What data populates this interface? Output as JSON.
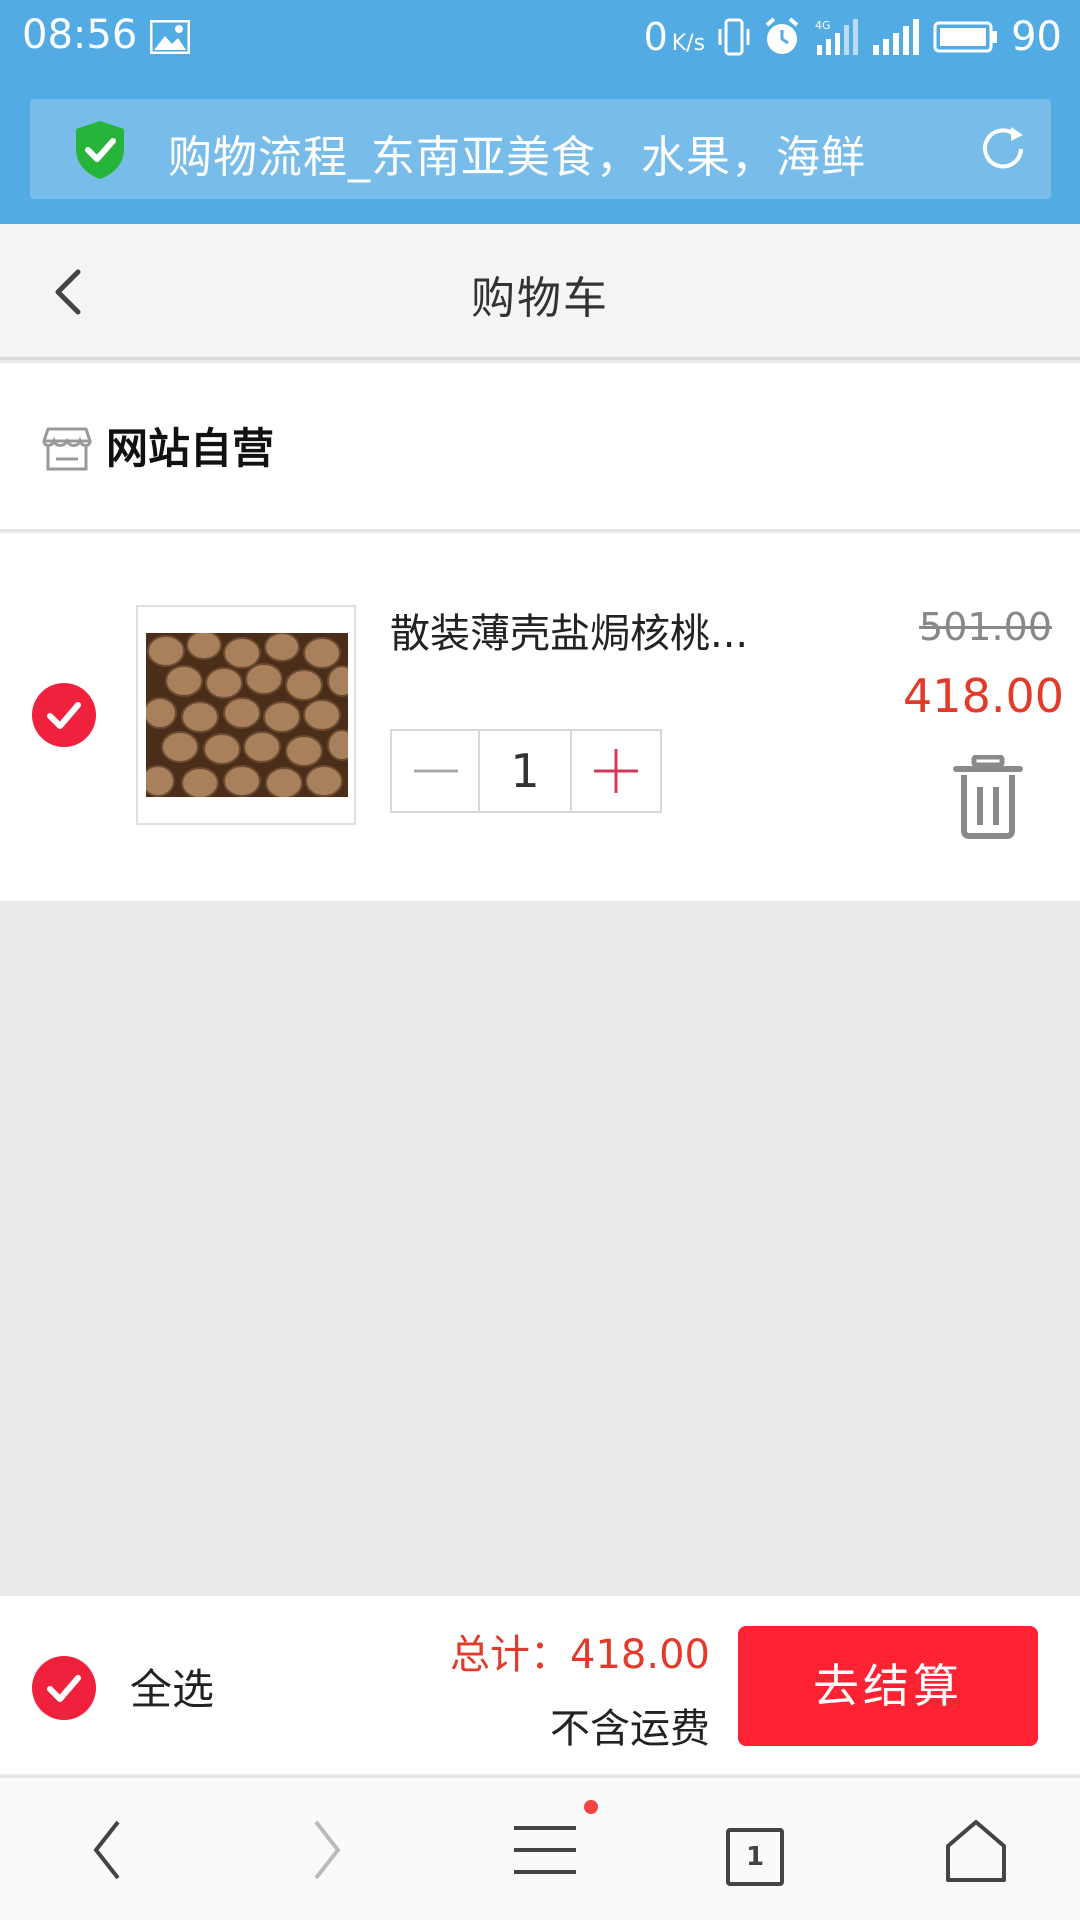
{
  "status_bar": {
    "time": "08:56",
    "net_speed": "0",
    "net_unit": "K/s",
    "battery": "90",
    "icons": [
      "gallery-icon",
      "vibrate-icon",
      "alarm-icon",
      "4g-signal-icon",
      "signal-icon",
      "battery-icon"
    ]
  },
  "browser": {
    "url_title": "购物流程_东南亚美食，水果，海鲜",
    "tab_count": "1"
  },
  "header": {
    "title": "购物车"
  },
  "store": {
    "name": "网站自营"
  },
  "cart_items": [
    {
      "name": "散装薄壳盐焗核桃...",
      "quantity": "1",
      "original_price": "501.00",
      "price": "418.00",
      "selected": true
    }
  ],
  "checkout": {
    "select_all_label": "全选",
    "total_label": "总计：",
    "total_value": "418.00",
    "shipping_note": "不含运费",
    "pay_button": "去结算"
  },
  "colors": {
    "status_bar": "#53abe4",
    "accent_red": "#fe2233",
    "price_red": "#e23a2b",
    "page_bg": "#e9eaea"
  }
}
